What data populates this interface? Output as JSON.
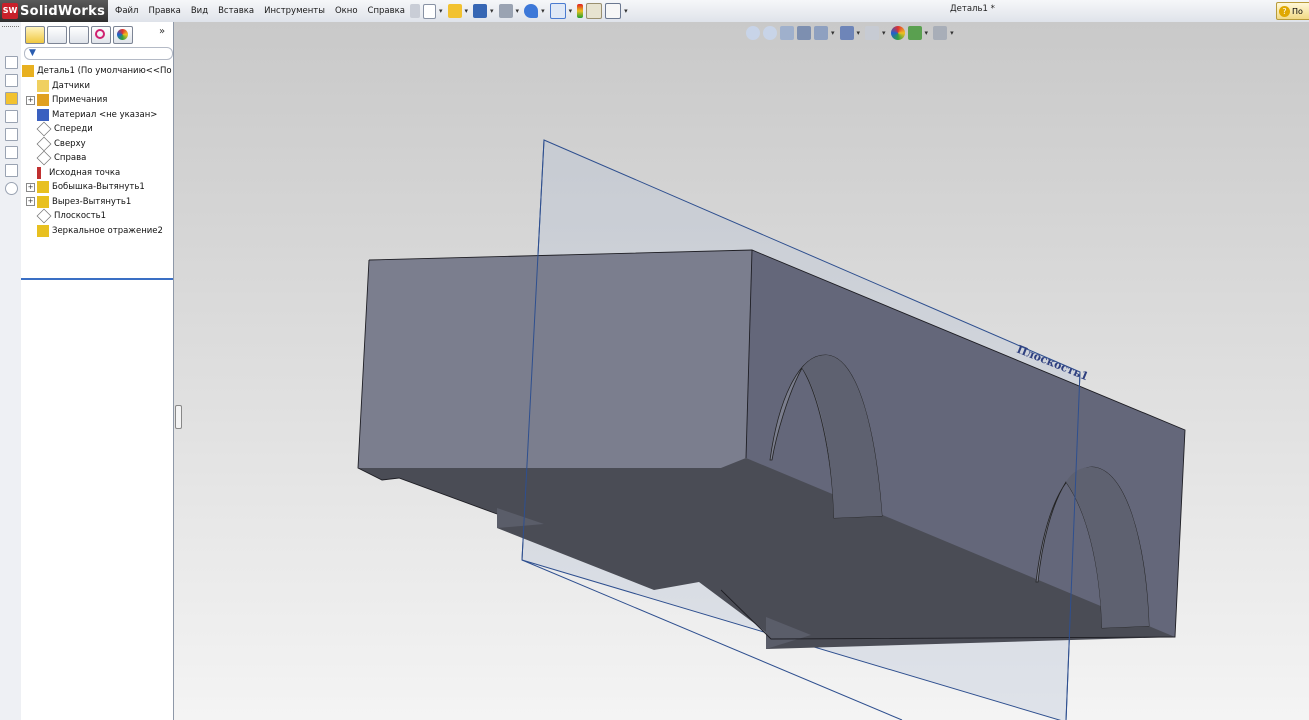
{
  "app": {
    "name": "SolidWorks",
    "logo_mark": "SW"
  },
  "menu": [
    "Файл",
    "Правка",
    "Вид",
    "Вставка",
    "Инструменты",
    "Окно",
    "Справка"
  ],
  "document_title": "Деталь1 *",
  "help_button_label": "По",
  "feature_manager": {
    "more_label": "»",
    "filter_icon": "filter-icon",
    "tree": [
      {
        "label": "Деталь1  (По умолчанию<<По у",
        "icon": "part-icon",
        "expandable": false,
        "indent": 0
      },
      {
        "label": "Датчики",
        "icon": "sensors-icon",
        "expandable": false,
        "indent": 1
      },
      {
        "label": "Примечания",
        "icon": "annotations-icon",
        "expandable": true,
        "indent": 1
      },
      {
        "label": "Материал <не указан>",
        "icon": "material-icon",
        "expandable": false,
        "indent": 1
      },
      {
        "label": "Спереди",
        "icon": "plane-icon",
        "expandable": false,
        "indent": 1
      },
      {
        "label": "Сверху",
        "icon": "plane-icon",
        "expandable": false,
        "indent": 1
      },
      {
        "label": "Справа",
        "icon": "plane-icon",
        "expandable": false,
        "indent": 1
      },
      {
        "label": "Исходная точка",
        "icon": "origin-icon",
        "expandable": false,
        "indent": 1
      },
      {
        "label": "Бобышка-Вытянуть1",
        "icon": "extrude-icon",
        "expandable": true,
        "indent": 1
      },
      {
        "label": "Вырез-Вытянуть1",
        "icon": "cut-icon",
        "expandable": true,
        "indent": 1
      },
      {
        "label": "Плоскость1",
        "icon": "plane-icon",
        "expandable": false,
        "indent": 1
      },
      {
        "label": "Зеркальное отражение2",
        "icon": "mirror-icon",
        "expandable": false,
        "indent": 1
      }
    ]
  },
  "viewport": {
    "plane_label": "Плоскость1"
  },
  "colors": {
    "accent": "#3a6fc4",
    "model_top": "#6b6f7d",
    "model_side": "#5a5d69",
    "model_bottom": "#4a4c55",
    "plane_edge": "#2e4f8f"
  }
}
